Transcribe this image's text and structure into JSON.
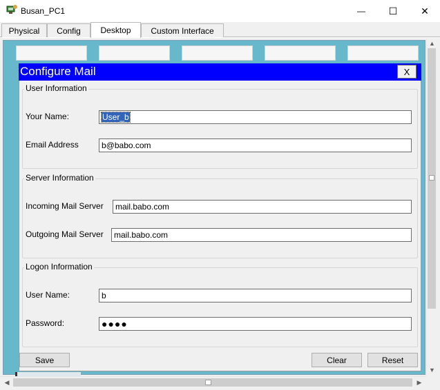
{
  "window": {
    "title": "Busan_PC1",
    "controls": {
      "minimize": "—",
      "maximize": "☐",
      "close": "✕"
    }
  },
  "tabs": [
    {
      "label": "Physical",
      "active": false
    },
    {
      "label": "Config",
      "active": false
    },
    {
      "label": "Desktop",
      "active": true
    },
    {
      "label": "Custom Interface",
      "active": false
    }
  ],
  "dialog": {
    "title": "Configure Mail",
    "close_label": "X",
    "user_info": {
      "legend": "User Information",
      "your_name_label": "Your Name:",
      "your_name_value": "User_b",
      "email_label": "Email Address",
      "email_value": "b@babo.com"
    },
    "server_info": {
      "legend": "Server Information",
      "incoming_label": "Incoming Mail Server",
      "incoming_value": "mail.babo.com",
      "outgoing_label": "Outgoing Mail Server",
      "outgoing_value": "mail.babo.com"
    },
    "logon_info": {
      "legend": "Logon Information",
      "username_label": "User Name:",
      "username_value": "b",
      "password_label": "Password:",
      "password_mask": "●●●●"
    },
    "buttons": {
      "save": "Save",
      "clear": "Clear",
      "reset": "Reset"
    }
  },
  "scrollbars": {
    "up": "▲",
    "down": "▼",
    "left": "◀",
    "right": "▶"
  },
  "colors": {
    "dialog_title_bg": "#0000ff",
    "desktop_bg": "#68b8cc",
    "selection": "#3264b9"
  }
}
